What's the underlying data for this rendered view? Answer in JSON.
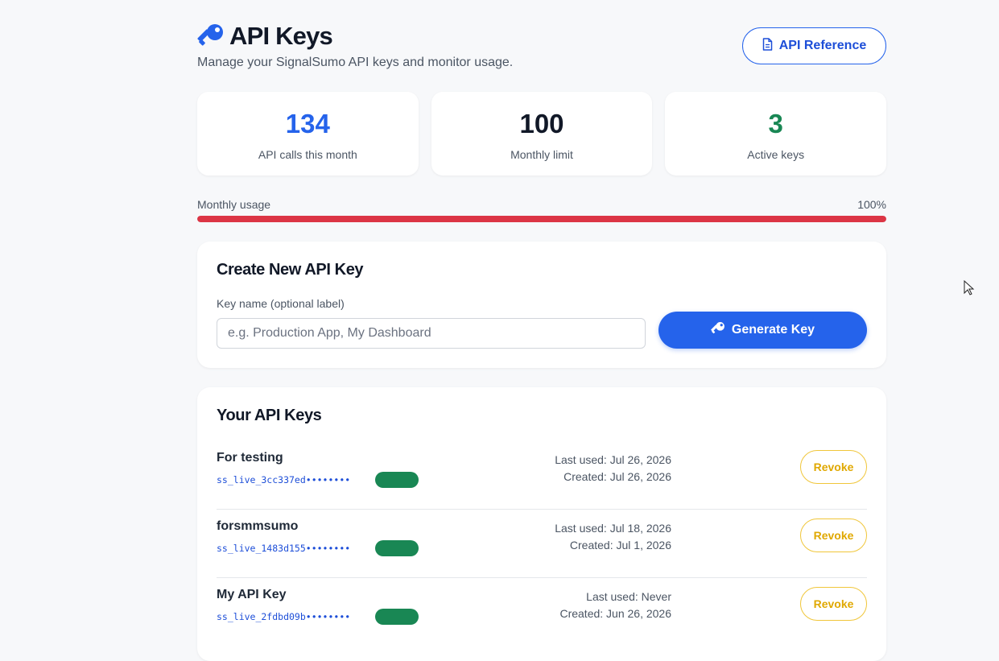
{
  "header": {
    "title": "API Keys",
    "subtitle": "Manage your SignalSumo API keys and monitor usage.",
    "reference_label": "API Reference"
  },
  "stats": [
    {
      "value": "134",
      "label": "API calls this month",
      "color": "#2563eb"
    },
    {
      "value": "100",
      "label": "Monthly limit",
      "color": "#111827"
    },
    {
      "value": "3",
      "label": "Active keys",
      "color": "#198754"
    }
  ],
  "usage": {
    "label": "Monthly usage",
    "percent_text": "100%",
    "percent": 100,
    "color": "#dc3545"
  },
  "create": {
    "title": "Create New API Key",
    "field_label": "Key name (optional label)",
    "placeholder": "e.g. Production App, My Dashboard",
    "button_label": "Generate Key"
  },
  "keys": {
    "title": "Your API Keys",
    "items": [
      {
        "name": "For testing",
        "key": "ss_live_3cc337ed••••••••",
        "last_used": "Last used: Jul 26, 2026",
        "created": "Created: Jul 26, 2026",
        "revoke_label": "Revoke"
      },
      {
        "name": "forsmmsumo",
        "key": "ss_live_1483d155••••••••",
        "last_used": "Last used: Jul 18, 2026",
        "created": "Created: Jul 1, 2026",
        "revoke_label": "Revoke"
      },
      {
        "name": "My API Key",
        "key": "ss_live_2fdbd09b••••••••",
        "last_used": "Last used: Never",
        "created": "Created: Jun 26, 2026",
        "revoke_label": "Revoke"
      }
    ]
  },
  "colors": {
    "accent": "#2563eb",
    "danger": "#dc3545",
    "success": "#198754",
    "warning": "#f0c63a"
  }
}
